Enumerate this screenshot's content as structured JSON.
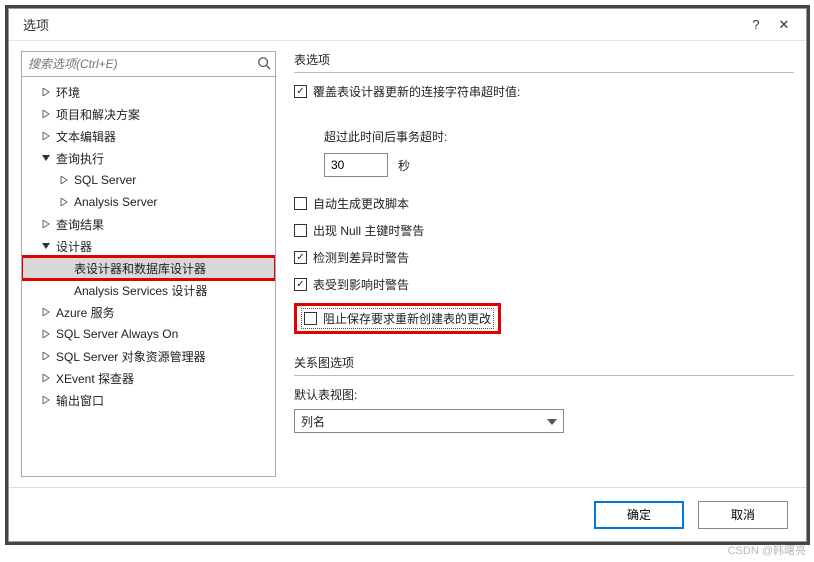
{
  "titlebar": {
    "title": "选项",
    "help": "?",
    "close": "✕"
  },
  "search": {
    "placeholder": "搜索选项(Ctrl+E)"
  },
  "tree": {
    "env": "环境",
    "proj": "项目和解决方案",
    "text": "文本编辑器",
    "query_exec": "查询执行",
    "sql_server": "SQL Server",
    "analysis_server": "Analysis Server",
    "query_result": "查询结果",
    "designer": "设计器",
    "table_designer": "表设计器和数据库设计器",
    "analysis_designer": "Analysis Services 设计器",
    "azure": "Azure 服务",
    "alwayson": "SQL Server Always On",
    "explorer": "SQL Server 对象资源管理器",
    "xevent": "XEvent 探查器",
    "output": "输出窗口"
  },
  "right": {
    "group1_title": "表选项",
    "override_conn_timeout": "覆盖表设计器更新的连接字符串超时值:",
    "timeout_label": "超过此时间后事务超时:",
    "timeout_value": "30",
    "seconds": "秒",
    "auto_gen_script": "自动生成更改脚本",
    "null_pk_warn": "出现 Null 主键时警告",
    "diff_warn": "检测到差异时警告",
    "affected_warn": "表受到影响时警告",
    "prevent_save": "阻止保存要求重新创建表的更改",
    "group2_title": "关系图选项",
    "default_view_label": "默认表视图:",
    "default_view_value": "列名"
  },
  "footer": {
    "ok": "确定",
    "cancel": "取消"
  },
  "watermark": "CSDN @韩曙亮"
}
